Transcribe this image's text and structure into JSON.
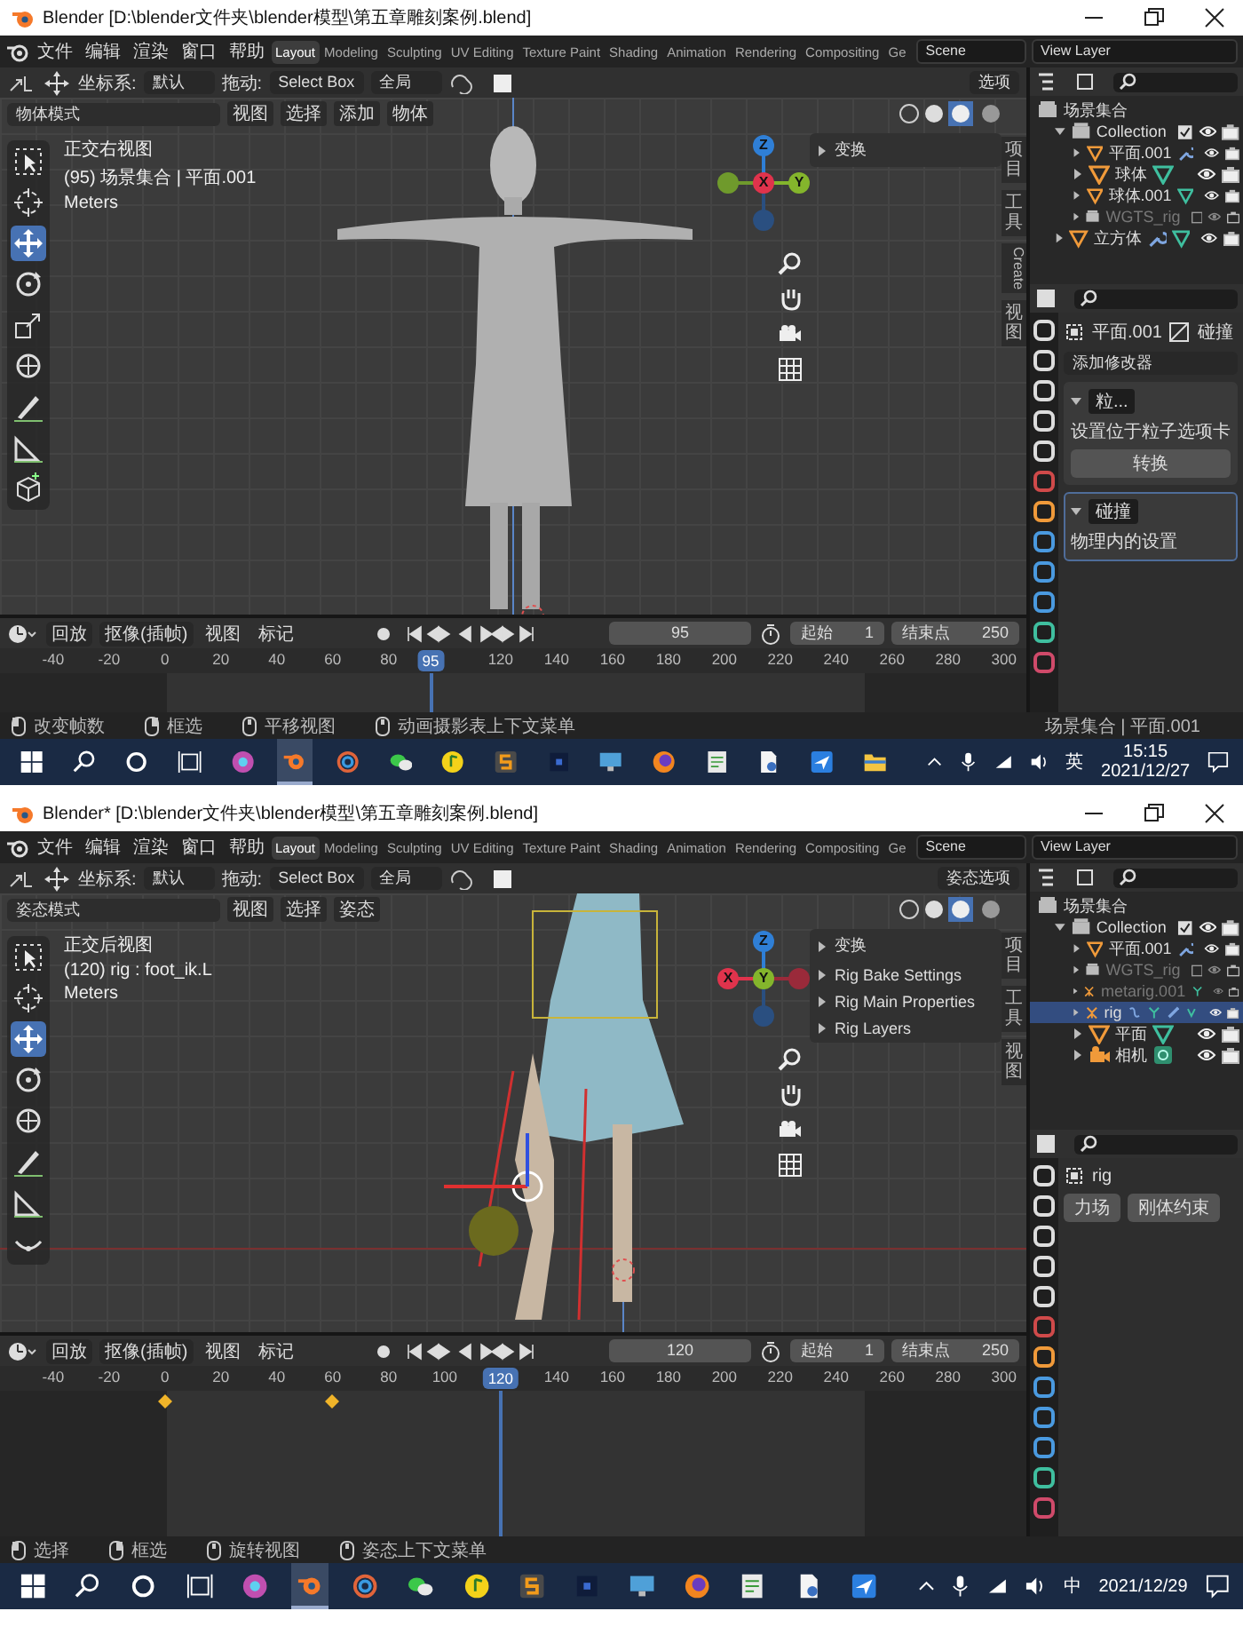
{
  "screens": [
    {
      "title": "Blender [D:\\blender文件夹\\blender模型\\第五章雕刻案例.blend]",
      "menus": [
        "文件",
        "编辑",
        "渲染",
        "窗口",
        "帮助"
      ],
      "workspaces": [
        {
          "label": "Layout",
          "selected": true
        },
        {
          "label": "Modeling",
          "selected": false
        },
        {
          "label": "Sculpting",
          "selected": false
        },
        {
          "label": "UV Editing",
          "selected": false
        },
        {
          "label": "Texture Paint",
          "selected": false
        },
        {
          "label": "Shading",
          "selected": false
        },
        {
          "label": "Animation",
          "selected": false
        },
        {
          "label": "Rendering",
          "selected": false
        },
        {
          "label": "Compositing",
          "selected": false
        },
        {
          "label": "Ge",
          "selected": false
        }
      ],
      "scene": "Scene",
      "view_layer": "View Layer",
      "tool_header": {
        "orientation_label": "坐标系:",
        "orientation": "默认",
        "drag_label": "拖动:",
        "drag": "Select Box",
        "pivot": "全局",
        "options": "选项"
      },
      "mode": "物体模式",
      "mode_menus": [
        "视图",
        "选择",
        "添加",
        "物体"
      ],
      "tools": [
        {
          "kind": "select",
          "selected": false
        },
        {
          "kind": "cursor",
          "selected": false
        },
        {
          "kind": "move",
          "selected": true
        },
        {
          "kind": "rotate",
          "selected": false
        },
        {
          "kind": "scale",
          "selected": false
        },
        {
          "kind": "transform",
          "selected": false
        },
        {
          "kind": "annotate",
          "selected": false
        },
        {
          "kind": "measure",
          "selected": false
        },
        {
          "kind": "cube",
          "selected": false
        }
      ],
      "viewport": {
        "kind": "tpose",
        "view_name": "正交右视图",
        "context": "(95) 场景集合 | 平面.001",
        "units": "Meters"
      },
      "gizmo": [
        {
          "kind": "left",
          "color": "#6f9a2c"
        },
        {
          "kind": "top",
          "label": "Z",
          "color": "#2f7fd6"
        },
        {
          "kind": "center",
          "label": "X",
          "color": "#e0334c"
        },
        {
          "kind": "right",
          "label": "Y",
          "color": "#84b52c"
        },
        {
          "kind": "bottom",
          "color": "#2a4f80"
        }
      ],
      "sidebar_tabs": [
        "项目",
        "工具",
        "Create",
        "视图"
      ],
      "sidebar_sections": [
        "变换"
      ],
      "outliner": {
        "root": "场景集合",
        "items": [
          {
            "name": "Collection",
            "kind": "collection",
            "expanded": true,
            "checked": true,
            "selected": false,
            "dimmed": false,
            "children": [
              {
                "name": "平面.001",
                "kind": "mesh",
                "expanded": false,
                "selected": false,
                "dimmed": false,
                "extras": [
                  {
                    "kind": "wrench"
                  }
                ]
              },
              {
                "name": "球体",
                "kind": "mesh",
                "expanded": false,
                "selected": false,
                "dimmed": false,
                "extras": [
                  {
                    "kind": "meshdata"
                  }
                ]
              },
              {
                "name": "球体.001",
                "kind": "mesh",
                "expanded": false,
                "selected": false,
                "dimmed": false,
                "extras": [
                  {
                    "kind": "meshdata"
                  }
                ]
              },
              {
                "name": "WGTS_rig",
                "kind": "collection",
                "expanded": false,
                "checked": false,
                "selected": false,
                "dimmed": true
              }
            ]
          },
          {
            "name": "立方体",
            "kind": "mesh",
            "expanded": false,
            "selected": false,
            "dimmed": false,
            "extras": [
              {
                "kind": "wrench"
              },
              {
                "kind": "meshdata"
              }
            ]
          }
        ]
      },
      "properties": {
        "kind": "modifiers",
        "object": "平面.001",
        "data": "碰撞",
        "add_modifier": "添加修改器",
        "modifiers": [
          {
            "name": "粒...",
            "note": "设置位于粒子选项卡",
            "button": "转换",
            "selected": false
          },
          {
            "name": "碰撞",
            "note": "物理内的设置",
            "selected": true
          }
        ]
      },
      "timeline": {
        "menus": [
          "回放",
          "抠像(插帧)",
          "视图",
          "标记"
        ],
        "current_frame": "95",
        "start_label": "起始",
        "start": "1",
        "end_label": "结束点",
        "end": "250",
        "ticks": [
          "-40",
          "-20",
          "0",
          "20",
          "40",
          "60",
          "80",
          "120",
          "140",
          "160",
          "180",
          "200",
          "220",
          "240",
          "260",
          "280",
          "300"
        ],
        "playhead_label": "95"
      },
      "status": [
        {
          "kind": "lmb",
          "hint": "改变帧数"
        },
        {
          "kind": "rmb",
          "hint": "框选"
        },
        {
          "kind": "mmb",
          "hint": "平移视图"
        },
        {
          "kind": "mmb",
          "hint": "动画摄影表上下文菜单"
        }
      ],
      "status_info": "场景集合 | 平面.001",
      "taskbar": {
        "apps": [
          {
            "kind": "disc",
            "selected": false
          },
          {
            "kind": "blender",
            "selected": true
          },
          {
            "kind": "ring",
            "selected": false
          },
          {
            "kind": "chat",
            "selected": false
          },
          {
            "kind": "music",
            "selected": false
          },
          {
            "kind": "editor",
            "selected": false
          },
          {
            "kind": "dark",
            "selected": false
          },
          {
            "kind": "monitor",
            "selected": false
          },
          {
            "kind": "browser",
            "selected": false
          },
          {
            "kind": "notes",
            "selected": false
          },
          {
            "kind": "script",
            "selected": false
          },
          {
            "kind": "bird",
            "selected": false
          },
          {
            "kind": "folder",
            "selected": false
          }
        ],
        "ime": "英",
        "time": "15:15",
        "date": "2021/12/27"
      }
    },
    {
      "title": "Blender* [D:\\blender文件夹\\blender模型\\第五章雕刻案例.blend]",
      "menus": [
        "文件",
        "编辑",
        "渲染",
        "窗口",
        "帮助"
      ],
      "workspaces": [
        {
          "label": "Layout",
          "selected": true
        },
        {
          "label": "Modeling",
          "selected": false
        },
        {
          "label": "Sculpting",
          "selected": false
        },
        {
          "label": "UV Editing",
          "selected": false
        },
        {
          "label": "Texture Paint",
          "selected": false
        },
        {
          "label": "Shading",
          "selected": false
        },
        {
          "label": "Animation",
          "selected": false
        },
        {
          "label": "Rendering",
          "selected": false
        },
        {
          "label": "Compositing",
          "selected": false
        },
        {
          "label": "Ge",
          "selected": false
        }
      ],
      "scene": "Scene",
      "view_layer": "View Layer",
      "tool_header": {
        "orientation_label": "坐标系:",
        "orientation": "默认",
        "drag_label": "拖动:",
        "drag": "Select Box",
        "pivot": "全局",
        "options": "姿态选项"
      },
      "mode": "姿态模式",
      "mode_menus": [
        "视图",
        "选择",
        "姿态"
      ],
      "tools": [
        {
          "kind": "select",
          "selected": false
        },
        {
          "kind": "cursor",
          "selected": false
        },
        {
          "kind": "move",
          "selected": true
        },
        {
          "kind": "rotate",
          "selected": false
        },
        {
          "kind": "transform",
          "selected": false
        },
        {
          "kind": "annotate",
          "selected": false
        },
        {
          "kind": "measure",
          "selected": false
        },
        {
          "kind": "relax",
          "selected": false
        }
      ],
      "viewport": {
        "kind": "rig",
        "view_name": "正交后视图",
        "context": "(120) rig : foot_ik.L",
        "units": "Meters"
      },
      "gizmo": [
        {
          "kind": "top",
          "label": "Z",
          "color": "#2f7fd6"
        },
        {
          "kind": "left",
          "label": "X",
          "color": "#e0334c"
        },
        {
          "kind": "center",
          "label": "Y",
          "color": "#84b52c"
        },
        {
          "kind": "right",
          "color": "#9a2a3a"
        },
        {
          "kind": "bottom",
          "color": "#2a4f80"
        }
      ],
      "sidebar_tabs": [
        "项目",
        "工具",
        "视图"
      ],
      "sidebar_sections": [
        "变换",
        "Rig Bake Settings",
        "Rig Main Properties",
        "Rig Layers"
      ],
      "outliner": {
        "root": "场景集合",
        "items": [
          {
            "name": "Collection",
            "kind": "collection",
            "expanded": true,
            "checked": true,
            "selected": false,
            "dimmed": false,
            "children": [
              {
                "name": "平面.001",
                "kind": "mesh",
                "expanded": false,
                "selected": false,
                "dimmed": false,
                "extras": [
                  {
                    "kind": "wrench"
                  }
                ]
              },
              {
                "name": "WGTS_rig",
                "kind": "collection",
                "expanded": false,
                "checked": false,
                "selected": false,
                "dimmed": true
              },
              {
                "name": "metarig.001",
                "kind": "armature",
                "expanded": false,
                "selected": false,
                "dimmed": true,
                "extras": [
                  {
                    "kind": "armdata"
                  }
                ]
              },
              {
                "name": "rig",
                "kind": "armature",
                "expanded": false,
                "selected": true,
                "dimmed": false,
                "extras": [
                  {
                    "kind": "pose"
                  },
                  {
                    "kind": "armdata"
                  },
                  {
                    "kind": "bone"
                  },
                  {
                    "kind": "constraint"
                  }
                ]
              },
              {
                "name": "平面",
                "kind": "mesh",
                "expanded": false,
                "selected": false,
                "dimmed": false,
                "extras": [
                  {
                    "kind": "meshdata"
                  }
                ]
              },
              {
                "name": "相机",
                "kind": "camera",
                "expanded": false,
                "selected": false,
                "dimmed": false,
                "extras": [
                  {
                    "kind": "camdata"
                  }
                ]
              }
            ]
          }
        ]
      },
      "properties": {
        "kind": "physics",
        "object": "rig",
        "buttons": [
          "力场",
          "刚体约束"
        ]
      },
      "timeline": {
        "menus": [
          "回放",
          "抠像(插帧)",
          "视图",
          "标记"
        ],
        "current_frame": "120",
        "start_label": "起始",
        "start": "1",
        "end_label": "结束点",
        "end": "250",
        "ticks": [
          "-40",
          "-20",
          "0",
          "20",
          "40",
          "60",
          "80",
          "100",
          "140",
          "160",
          "180",
          "200",
          "220",
          "240",
          "260",
          "280",
          "300"
        ],
        "playhead_label": "120",
        "keyframes": [
          {
            "level": 0.161
          },
          {
            "level": 0.324
          }
        ]
      },
      "status": [
        {
          "kind": "lmb",
          "hint": "选择"
        },
        {
          "kind": "rmb",
          "hint": "框选"
        },
        {
          "kind": "mmb",
          "hint": "旋转视图"
        },
        {
          "kind": "mmb",
          "hint": "姿态上下文菜单"
        }
      ],
      "taskbar": {
        "apps": [
          {
            "kind": "disc",
            "selected": false
          },
          {
            "kind": "blender",
            "selected": true
          },
          {
            "kind": "ring",
            "selected": false
          },
          {
            "kind": "chat",
            "selected": false
          },
          {
            "kind": "music",
            "selected": false
          },
          {
            "kind": "editor",
            "selected": false
          },
          {
            "kind": "dark",
            "selected": false
          },
          {
            "kind": "monitor",
            "selected": false
          },
          {
            "kind": "browser",
            "selected": false
          },
          {
            "kind": "notes",
            "selected": false
          },
          {
            "kind": "script",
            "selected": false
          },
          {
            "kind": "bird",
            "selected": false
          }
        ],
        "ime": "中",
        "date": "2021/12/29"
      }
    }
  ]
}
